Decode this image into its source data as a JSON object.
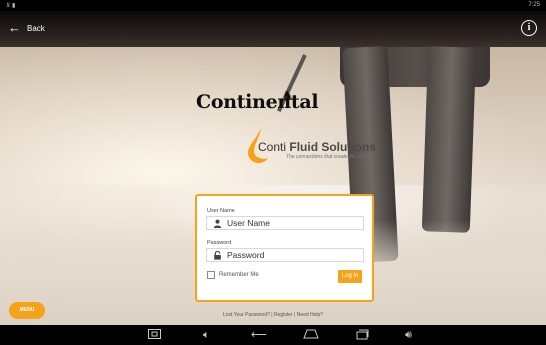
{
  "status": {
    "left_icons": "⊻ ▮",
    "right_text": "7:25"
  },
  "appbar": {
    "back_label": "Back",
    "info_glyph": "i"
  },
  "brand": {
    "continental": "Continental",
    "conti_light": "Conti",
    "conti_bold": "Fluid Solutions",
    "tagline": "The connections that create the future"
  },
  "login": {
    "username_label": "User Name",
    "username_placeholder": "User Name",
    "password_label": "Password",
    "password_placeholder": "Password",
    "remember_label": "Remember Me",
    "login_button": "Log in"
  },
  "links": {
    "lost_password": "Lost Your Password?",
    "register": "Register",
    "need_help": "Need Help?",
    "separator": " | "
  },
  "menu_button": "MENU",
  "colors": {
    "accent": "#f5a31a",
    "appbar": "#1a1412",
    "navbar": "#000000"
  },
  "icons": {
    "back": "arrow-left-icon",
    "info": "info-icon",
    "user": "user-icon",
    "lock": "lock-icon",
    "screenshot": "screenshot-icon",
    "volume_down": "volume-down-icon",
    "back_nav": "nav-back-icon",
    "home": "home-icon",
    "recents": "recents-icon",
    "volume_up": "volume-up-icon"
  }
}
